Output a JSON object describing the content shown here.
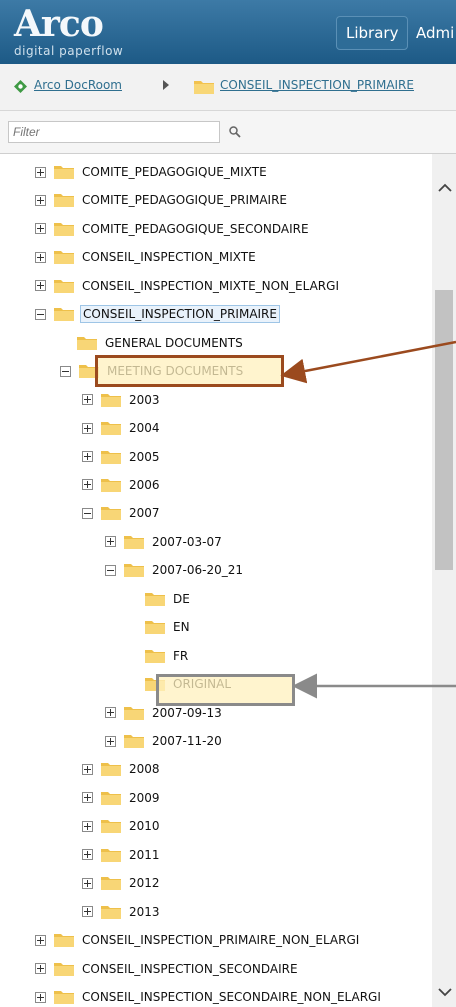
{
  "header": {
    "logo_main": "Arco",
    "logo_sub": "digital paperflow",
    "tabs": [
      "Library",
      "Admi"
    ]
  },
  "breadcrumb": {
    "home": "Arco DocRoom",
    "current": "CONSEIL_INSPECTION_PRIMAIRE"
  },
  "filter": {
    "placeholder": "Filter"
  },
  "tree": [
    {
      "label": "COMITE_PEDAGOGIQUE_MIXTE",
      "level": 0,
      "exp": "plus"
    },
    {
      "label": "COMITE_PEDAGOGIQUE_PRIMAIRE",
      "level": 0,
      "exp": "plus"
    },
    {
      "label": "COMITE_PEDAGOGIQUE_SECONDAIRE",
      "level": 0,
      "exp": "plus"
    },
    {
      "label": "CONSEIL_INSPECTION_MIXTE",
      "level": 0,
      "exp": "plus"
    },
    {
      "label": "CONSEIL_INSPECTION_MIXTE_NON_ELARGI",
      "level": 0,
      "exp": "plus"
    },
    {
      "label": "CONSEIL_INSPECTION_PRIMAIRE",
      "level": 0,
      "exp": "minus",
      "selected": true
    },
    {
      "label": "GENERAL DOCUMENTS",
      "level": 1,
      "exp": "none"
    },
    {
      "label": "MEETING DOCUMENTS",
      "level": 1,
      "exp": "minus"
    },
    {
      "label": "2003",
      "level": 2,
      "exp": "plus"
    },
    {
      "label": "2004",
      "level": 2,
      "exp": "plus"
    },
    {
      "label": "2005",
      "level": 2,
      "exp": "plus"
    },
    {
      "label": "2006",
      "level": 2,
      "exp": "plus"
    },
    {
      "label": "2007",
      "level": 2,
      "exp": "minus"
    },
    {
      "label": "2007-03-07",
      "level": 3,
      "exp": "plus"
    },
    {
      "label": "2007-06-20_21",
      "level": 3,
      "exp": "minus"
    },
    {
      "label": "DE",
      "level": 4,
      "exp": "none"
    },
    {
      "label": "EN",
      "level": 4,
      "exp": "none"
    },
    {
      "label": "FR",
      "level": 4,
      "exp": "none"
    },
    {
      "label": "ORIGINAL",
      "level": 4,
      "exp": "none"
    },
    {
      "label": "2007-09-13",
      "level": 3,
      "exp": "plus"
    },
    {
      "label": "2007-11-20",
      "level": 3,
      "exp": "plus"
    },
    {
      "label": "2008",
      "level": 2,
      "exp": "plus"
    },
    {
      "label": "2009",
      "level": 2,
      "exp": "plus"
    },
    {
      "label": "2010",
      "level": 2,
      "exp": "plus"
    },
    {
      "label": "2011",
      "level": 2,
      "exp": "plus"
    },
    {
      "label": "2012",
      "level": 2,
      "exp": "plus"
    },
    {
      "label": "2013",
      "level": 2,
      "exp": "plus"
    },
    {
      "label": "CONSEIL_INSPECTION_PRIMAIRE_NON_ELARGI",
      "level": 0,
      "exp": "plus"
    },
    {
      "label": "CONSEIL_INSPECTION_SECONDAIRE",
      "level": 0,
      "exp": "plus"
    },
    {
      "label": "CONSEIL_INSPECTION_SECONDAIRE_NON_ELARGI",
      "level": 0,
      "exp": "plus"
    }
  ],
  "colors": {
    "header": "#1d5a86",
    "folder": "#f5cb5c",
    "callout_meeting": "#9b4a1e",
    "callout_original": "#8a8a8a"
  },
  "icons": {
    "home": "arco-docroom-icon",
    "folder": "folder-icon",
    "filter": "search-icon"
  }
}
